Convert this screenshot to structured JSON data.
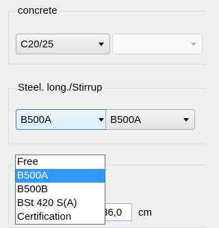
{
  "concrete": {
    "title": "concrete",
    "grade_value": "C20/25",
    "second_value": ""
  },
  "steel": {
    "title": "Steel. long./Stirrup",
    "longitudinal_value": "B500A",
    "stirrup_value": "B500A"
  },
  "dropdown": {
    "options": [
      "Free",
      "B500A",
      "B500B",
      "BSt 420 S(A)",
      "Certification"
    ],
    "selected": "B500A"
  },
  "cover": {
    "value": "36,0",
    "unit": "cm"
  }
}
